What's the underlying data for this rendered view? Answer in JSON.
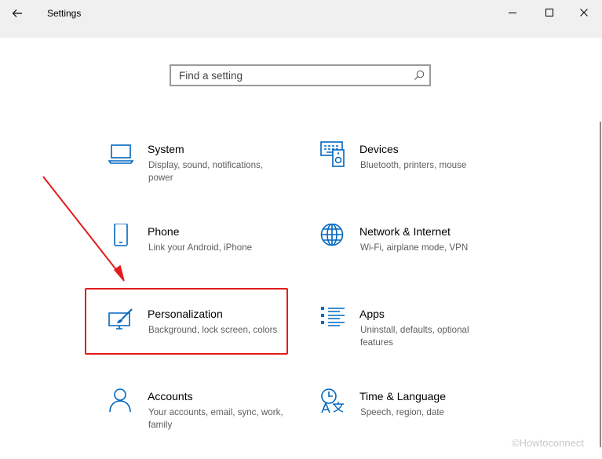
{
  "window": {
    "title": "Settings",
    "back_icon": "back-arrow-icon",
    "controls": [
      "minimize-icon",
      "maximize-icon",
      "close-icon"
    ]
  },
  "search": {
    "placeholder": "Find a setting",
    "value": "",
    "icon": "search-icon"
  },
  "tiles": [
    {
      "title": "System",
      "description": "Display, sound, notifications, power",
      "icon": "laptop-icon"
    },
    {
      "title": "Devices",
      "description": "Bluetooth, printers, mouse",
      "icon": "devices-icon"
    },
    {
      "title": "Phone",
      "description": "Link your Android, iPhone",
      "icon": "phone-icon"
    },
    {
      "title": "Network & Internet",
      "description": "Wi-Fi, airplane mode, VPN",
      "icon": "globe-icon"
    },
    {
      "title": "Personalization",
      "description": "Background, lock screen, colors",
      "icon": "paintbrush-icon"
    },
    {
      "title": "Apps",
      "description": "Uninstall, defaults, optional features",
      "icon": "apps-list-icon"
    },
    {
      "title": "Accounts",
      "description": "Your accounts, email, sync, work, family",
      "icon": "person-icon"
    },
    {
      "title": "Time & Language",
      "description": "Speech, region, date",
      "icon": "time-language-icon"
    }
  ],
  "annotation": {
    "highlight_color": "#e31b1b",
    "highlight_target": "Personalization"
  },
  "watermark": "©Howtoconnect",
  "colors": {
    "accent": "#0067c0",
    "titlebar": "#f0f0f0",
    "annotation": "#e31b1b"
  }
}
